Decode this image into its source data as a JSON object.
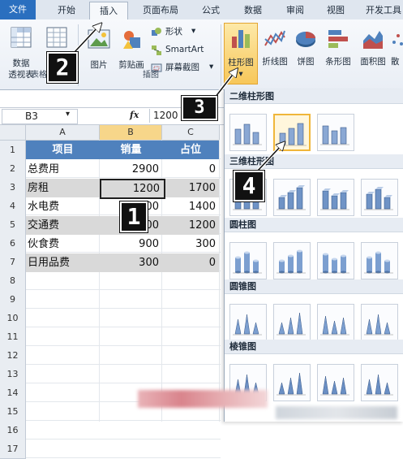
{
  "tabs": [
    "文件",
    "开始",
    "插入",
    "页面布局",
    "公式",
    "数据",
    "审阅",
    "视图",
    "开发工具"
  ],
  "active_tab": "插入",
  "ribbon": {
    "pivot_label_1": "数据",
    "pivot_label_2": "透视表",
    "picture_label": "图片",
    "clipart_label": "剪贴画",
    "shapes_label": "形状",
    "smartart_label": "SmartArt",
    "screenshot_label": "屏幕截图",
    "column_chart_label": "柱形图",
    "line_chart_label": "折线图",
    "pie_chart_label": "饼图",
    "bar_chart_label": "条形图",
    "area_chart_label": "面积图",
    "scatter_label": "散",
    "group_tables": "表格",
    "group_illustrations": "插图"
  },
  "formula_bar": {
    "name_box": "B3",
    "fx": "fx",
    "value": "1200"
  },
  "columns": [
    "A",
    "B",
    "C"
  ],
  "rows": [
    "1",
    "2",
    "3",
    "4",
    "5",
    "6",
    "7",
    "8",
    "9",
    "10",
    "11",
    "12",
    "13",
    "14",
    "15",
    "16",
    "17"
  ],
  "table": {
    "headers": [
      "项目",
      "销量",
      "占位"
    ],
    "data": [
      [
        "总费用",
        "2900",
        "0"
      ],
      [
        "房租",
        "1200",
        "1700"
      ],
      [
        "水电费",
        "1500",
        "1400"
      ],
      [
        "交通费",
        "200",
        "1200"
      ],
      [
        "伙食费",
        "900",
        "300"
      ],
      [
        "日用品费",
        "300",
        "0"
      ]
    ]
  },
  "chart_menu": {
    "sections": [
      "二维柱形图",
      "三维柱形图",
      "圆柱图",
      "圆锥图",
      "棱锥图"
    ]
  },
  "callouts": [
    "2",
    "3",
    "4",
    "1"
  ],
  "colors": {
    "header_blue": "#4f81bd",
    "band_gray": "#d9d9d9",
    "highlight": "#f0b63a",
    "file_tab": "#2a6fbf"
  }
}
